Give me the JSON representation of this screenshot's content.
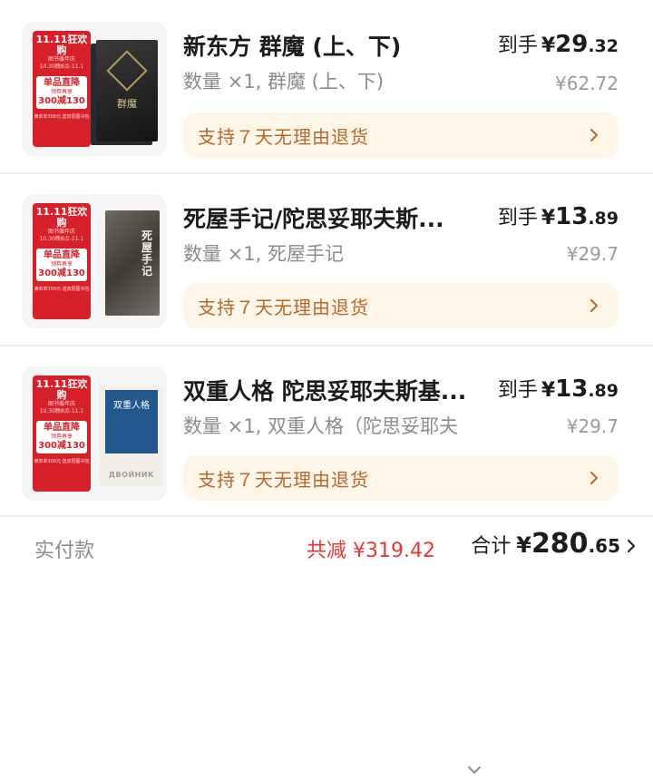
{
  "items": [
    {
      "title": "新东方 群魔 (上、下)",
      "spec": "数量 ×1, 群魔 (上、下)",
      "price_label": "到手",
      "price_symbol": "¥",
      "price_int": "29",
      "price_dec": ".32",
      "original_price": "¥62.72",
      "service": "支持７天无理由退货",
      "cover_title": "群魔"
    },
    {
      "title": "死屋手记/陀思妥耶夫斯...",
      "spec": "数量 ×1, 死屋手记",
      "price_label": "到手",
      "price_symbol": "¥",
      "price_int": "13",
      "price_dec": ".89",
      "original_price": "¥29.7",
      "service": "支持７天无理由退货",
      "cover_title": "死屋手记"
    },
    {
      "title": "双重人格 陀思妥耶夫斯基...",
      "spec": "数量 ×1, 双重人格（陀思妥耶夫",
      "price_label": "到手",
      "price_symbol": "¥",
      "price_int": "13",
      "price_dec": ".89",
      "original_price": "¥29.7",
      "service": "支持７天无理由退货",
      "cover_title": "双重人格",
      "cover_latin": "ДВОЙНИК"
    }
  ],
  "promo": {
    "head": "11.11狂欢购",
    "sub": "图书循年庆",
    "date": "10.30晚8点-11.1",
    "badge": "单品直降",
    "badge_sub": "领券再享",
    "badge_amount": "300减130",
    "foot": "满单单300元 送双层图书包"
  },
  "footer": {
    "paid_label": "实付款",
    "discount": "共减 ¥319.42",
    "total_label": "合计",
    "total_symbol": "¥",
    "total_int": "280",
    "total_dec": ".65"
  },
  "colors": {
    "accent_red": "#e53935",
    "service_bg": "#fff6ea",
    "service_text": "#b8682a",
    "muted": "#8c8c8c"
  }
}
